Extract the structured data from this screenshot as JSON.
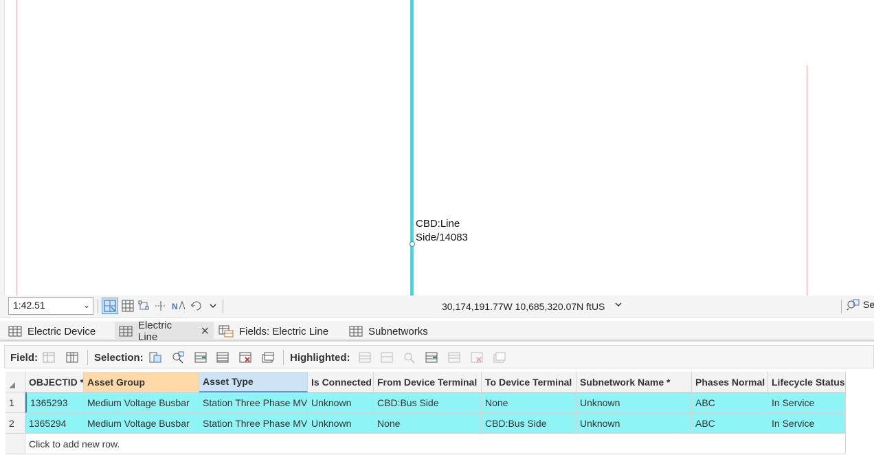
{
  "map": {
    "label": "CBD:Line\nSide/14083"
  },
  "statusbar": {
    "scale": "1:42.51",
    "coordinates": "30,174,191.77W 10,685,320.07N ftUS",
    "search_partial": "Se"
  },
  "tabs": [
    {
      "label": "Electric Device",
      "icon": "table-icon"
    },
    {
      "label": "Electric Line",
      "icon": "table-icon",
      "active": true
    },
    {
      "label": "Fields: Electric Line",
      "icon": "fields-icon"
    },
    {
      "label": "Subnetworks",
      "icon": "table-icon"
    }
  ],
  "toolbar": {
    "field_label": "Field:",
    "selection_label": "Selection:",
    "highlighted_label": "Highlighted:"
  },
  "table": {
    "columns": [
      "OBJECTID *",
      "Asset Group",
      "Asset Type",
      "Is Connected",
      "From Device Terminal",
      "To Device Terminal",
      "Subnetwork Name *",
      "Phases Normal",
      "Lifecycle Status"
    ],
    "rows": [
      {
        "num": "1",
        "cells": [
          "1365293",
          "Medium Voltage Busbar",
          "Station Three Phase MV",
          "Unknown",
          "CBD:Bus Side",
          "None",
          "Unknown",
          "ABC",
          "In Service"
        ]
      },
      {
        "num": "2",
        "cells": [
          "1365294",
          "Medium Voltage Busbar",
          "Station Three Phase MV",
          "Unknown",
          "None",
          "CBD:Bus Side",
          "Unknown",
          "ABC",
          "In Service"
        ]
      }
    ],
    "add_row_text": "Click to add new row."
  },
  "colors": {
    "selection_cyan": "#8ef4f6",
    "line_cyan": "#3ee8ee",
    "accent_blue": "#5b9bd5",
    "header_orange": "#ffd9a8"
  }
}
